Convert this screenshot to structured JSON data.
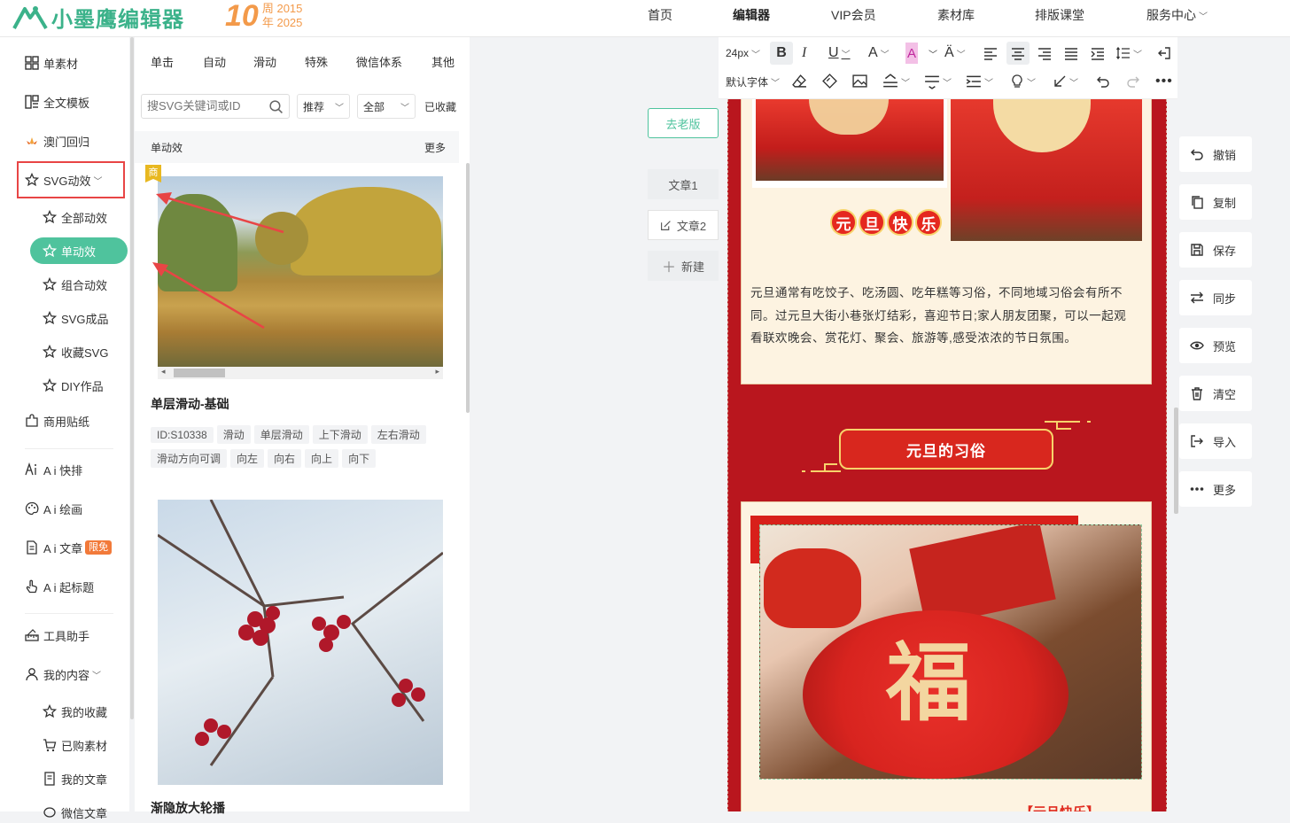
{
  "brand": {
    "name": "小墨鹰编辑器",
    "anniv_number": "10",
    "anniv_word": "周年",
    "anniv_years": [
      "2015",
      "2025"
    ]
  },
  "nav": [
    {
      "label": "首页"
    },
    {
      "label": "编辑器"
    },
    {
      "label": "VIP会员"
    },
    {
      "label": "素材库"
    },
    {
      "label": "排版课堂"
    },
    {
      "label": "服务中心"
    }
  ],
  "sidebar": {
    "items": [
      {
        "label": "单素材"
      },
      {
        "label": "全文模板"
      },
      {
        "label": "澳门回归"
      },
      {
        "label": "SVG动效"
      },
      {
        "label": "全部动效"
      },
      {
        "label": "单动效"
      },
      {
        "label": "组合动效"
      },
      {
        "label": "SVG成品"
      },
      {
        "label": "收藏SVG"
      },
      {
        "label": "DIY作品"
      },
      {
        "label": "商用贴纸"
      },
      {
        "label": "A i 快排"
      },
      {
        "label": "A i 绘画"
      },
      {
        "label": "A i 文章"
      },
      {
        "label": "A i 起标题"
      },
      {
        "label": "工具助手"
      },
      {
        "label": "我的内容"
      },
      {
        "label": "我的收藏"
      },
      {
        "label": "已购素材"
      },
      {
        "label": "我的文章"
      },
      {
        "label": "微信文章"
      }
    ],
    "ai_article_badge": "限免"
  },
  "panel": {
    "categories": [
      "单击",
      "自动",
      "滑动",
      "特殊",
      "微信体系",
      "其他"
    ],
    "search_placeholder": "搜SVG关键词或ID",
    "sort": "推荐",
    "filter": "全部",
    "favorited": "已收藏",
    "section_title": "单动效",
    "section_more": "更多",
    "cards": [
      {
        "badge": "商",
        "title": "单层滑动-基础",
        "tags": [
          "ID:S10338",
          "滑动",
          "单层滑动",
          "上下滑动",
          "左右滑动",
          "滑动方向可调",
          "向左",
          "向右",
          "向上",
          "向下"
        ]
      },
      {
        "title": "渐隐放大轮播"
      }
    ]
  },
  "middle": {
    "old_version": "去老版",
    "articles": [
      "文章1",
      "文章2"
    ],
    "new_label": "新建"
  },
  "toolbar": {
    "font_size": "24px",
    "font_family": "默认字体"
  },
  "canvas": {
    "banner_chars": [
      "元",
      "旦",
      "快",
      "乐"
    ],
    "paragraph": "元旦通常有吃饺子、吃汤圆、吃年糕等习俗，不同地域习俗会有所不同。过元旦大街小巷张灯结彩，喜迎节日;家人朋友团聚，可以一起观看联欢晚会、赏花灯、聚会、旅游等,感受浓浓的节日氛围。",
    "section_title": "元旦的习俗",
    "fu_char": "福",
    "bottom_caption": "【元旦快乐】"
  },
  "actions": [
    "撤销",
    "复制",
    "保存",
    "同步",
    "预览",
    "清空",
    "导入",
    "更多"
  ],
  "colors": {
    "accent": "#4fc39d",
    "canvas_red": "#b9161e",
    "highlight": "#e84545",
    "anniv": "#f39a4a"
  }
}
